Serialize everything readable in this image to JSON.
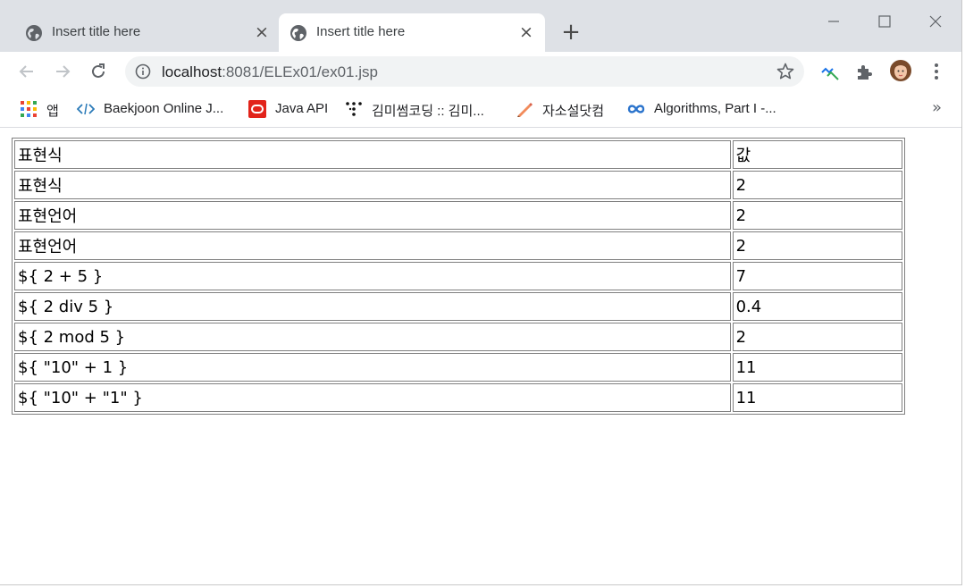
{
  "tabs": [
    {
      "title": "Insert title here",
      "close": "×",
      "active": false
    },
    {
      "title": "Insert title here",
      "close": "×",
      "active": true
    }
  ],
  "new_tab": "+",
  "address": {
    "host": "localhost",
    "rest": ":8081/ELEx01/ex01.jsp"
  },
  "bookmarks": [
    {
      "icon": "apps-grid-icon",
      "label": "앱"
    },
    {
      "icon": "code-brackets-icon",
      "label": "Baekjoon Online J..."
    },
    {
      "icon": "oracle-icon",
      "label": "Java API"
    },
    {
      "icon": "dots-logo-icon",
      "label": "김미썸코딩 :: 김미..."
    },
    {
      "icon": "pencil-icon",
      "label": "자소설닷컴"
    },
    {
      "icon": "coursera-infinity-icon",
      "label": "Algorithms, Part I -..."
    }
  ],
  "bookmarks_more": "»",
  "table": {
    "header": [
      "표현식",
      "값"
    ],
    "rows": [
      [
        "표현식",
        "2"
      ],
      [
        "표현언어",
        "2"
      ],
      [
        "표현언어",
        "2"
      ],
      [
        "${ 2 + 5 }",
        "7"
      ],
      [
        "${ 2 div 5 }",
        "0.4"
      ],
      [
        "${ 2 mod 5 }",
        "2"
      ],
      [
        "${ \"10\" + 1 }",
        "11"
      ],
      [
        "${ \"10\" + \"1\" }",
        "11"
      ]
    ]
  },
  "colors": {
    "tabstrip": "#dee1e6",
    "omnibox": "#f1f3f4",
    "border": "#808080"
  }
}
